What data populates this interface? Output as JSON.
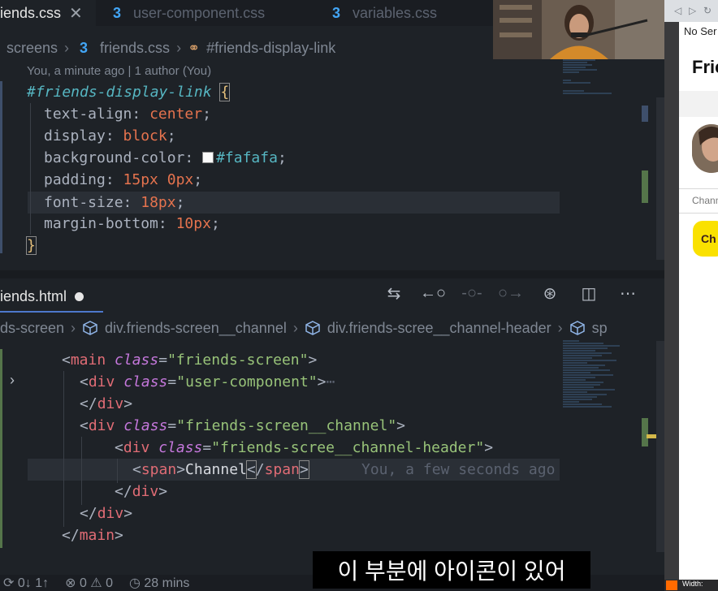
{
  "css_editor": {
    "tabs": [
      {
        "label": "iends.css",
        "active": true
      },
      {
        "label": "user-component.css",
        "active": false
      },
      {
        "label": "variables.css",
        "active": false
      }
    ],
    "breadcrumb": [
      "screens",
      "friends.css",
      "#friends-display-link"
    ],
    "blame": "You, a minute ago | 1 author (You)",
    "selector": "#friends-display-link",
    "declarations": [
      {
        "prop": "text-align",
        "value": "center"
      },
      {
        "prop": "display",
        "value": "block"
      },
      {
        "prop": "background-color",
        "value": "#fafafa",
        "swatch": "#fafafa"
      },
      {
        "prop": "padding",
        "value": "15px 0px"
      },
      {
        "prop": "font-size",
        "value": "18px"
      },
      {
        "prop": "margin-bottom",
        "value": "10px"
      }
    ]
  },
  "html_editor": {
    "tab_label": "iends.html",
    "breadcrumb": [
      "ds-screen",
      "div.friends-screen__channel",
      "div.friends-scree__channel-header",
      "sp"
    ],
    "code": {
      "main_class": "friends-screen",
      "div1_class": "user-component",
      "fold_marker": "⋯",
      "div2_class": "friends-screen__channel",
      "div3_class": "friends-scree__channel-header",
      "span_text": "Channel",
      "ghost_blame": "You, a few seconds ago"
    }
  },
  "statusbar": {
    "sync": "⟳ 0↓ 1↑",
    "problems": "⊗ 0 ⚠ 0",
    "time": "◷ 28 mins"
  },
  "subtitle": "이 부분에 아이콘이 있어",
  "browser": {
    "server_text": "No Ser",
    "title": "Frie",
    "channel_label": "Chann",
    "kakao_text": "Ch",
    "width_label": "Width:"
  }
}
